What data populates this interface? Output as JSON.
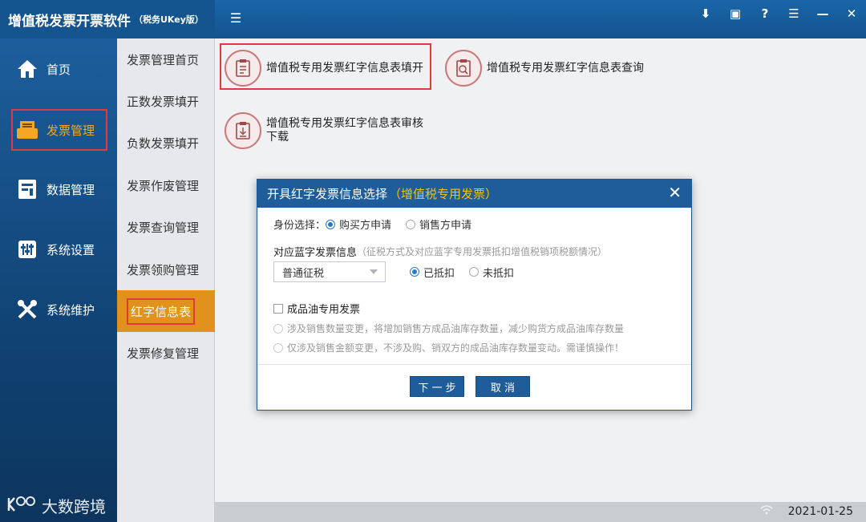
{
  "app": {
    "title": "增值税发票开票软件",
    "subtitle": "（税务UKey版）"
  },
  "toolbar": {
    "collapse_icon": "☰",
    "controls": [
      "⬇",
      "▣",
      "?",
      "☰",
      "—",
      "✕"
    ]
  },
  "sidebar": {
    "items": [
      {
        "label": "首页",
        "icon": "home-icon"
      },
      {
        "label": "发票管理",
        "icon": "invoice-icon"
      },
      {
        "label": "数据管理",
        "icon": "data-icon"
      },
      {
        "label": "系统设置",
        "icon": "settings-icon"
      },
      {
        "label": "系统维护",
        "icon": "maintenance-icon"
      }
    ],
    "active": "发票管理",
    "watermark": "大数跨境"
  },
  "subnav": {
    "items": [
      "发票管理首页",
      "正数发票填开",
      "负数发票填开",
      "发票作废管理",
      "发票查询管理",
      "发票领购管理",
      "红字信息表",
      "发票修复管理"
    ],
    "active": "红字信息表"
  },
  "functions": [
    {
      "label": "增值税专用发票红字信息表填开",
      "icon": "fill-form-icon"
    },
    {
      "label": "增值税专用发票红字信息表查询",
      "icon": "query-icon"
    },
    {
      "label": "增值税专用发票红字信息表审核下载",
      "icon": "download-icon"
    }
  ],
  "dialog": {
    "title": "开具红字发票信息选择",
    "title_highlight": "（增值税专用发票）",
    "identity_label": "身份选择：",
    "identity_options": [
      "购买方申请",
      "销售方申请"
    ],
    "blue_info_label": "对应蓝字发票信息",
    "blue_info_hint": "（征税方式及对应蓝字专用发票抵扣增值税销项税额情况）",
    "tax_method_value": "普通征税",
    "deduct_options": [
      "已抵扣",
      "未抵扣"
    ],
    "oil_label": "成品油专用发票",
    "oil_options": [
      "涉及销售数量变更，将增加销售方成品油库存数量，减少购货方成品油库存数量",
      "仅涉及销售金额变更，不涉及购、销双方的成品油库存数量变动。需谨慎操作！"
    ],
    "next_button": "下 一 步",
    "cancel_button": "取  消"
  },
  "status": {
    "date": "2021-01-25"
  },
  "colors": {
    "accent": "#1e5d9a",
    "highlight": "#f5c400",
    "active_nav": "#e0921c",
    "annotation_red": "#e4393c"
  }
}
